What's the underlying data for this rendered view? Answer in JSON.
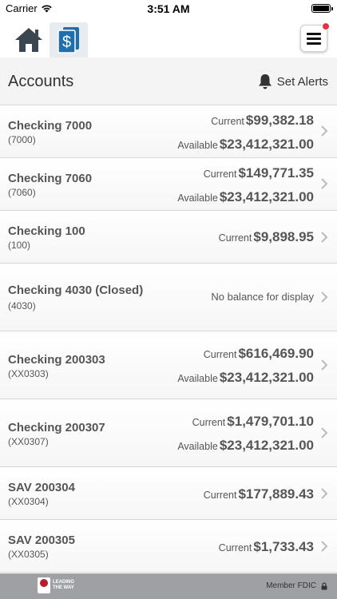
{
  "status_bar": {
    "carrier": "Carrier",
    "time": "3:51 AM"
  },
  "nav": {
    "home_icon": "house-icon",
    "accounts_icon": "dollar-document-icon",
    "menu_icon": "hamburger-icon"
  },
  "header": {
    "title": "Accounts",
    "alerts_label": "Set Alerts"
  },
  "accounts": [
    {
      "name": "Checking 7000",
      "number": "(7000)",
      "balances": [
        {
          "label": "Current",
          "amount": "$99,382.18"
        },
        {
          "label": "Available",
          "amount": "$23,412,321.00"
        }
      ]
    },
    {
      "name": "Checking 7060",
      "number": "(7060)",
      "balances": [
        {
          "label": "Current",
          "amount": "$149,771.35"
        },
        {
          "label": "Available",
          "amount": "$23,412,321.00"
        }
      ]
    },
    {
      "name": "Checking 100",
      "number": "(100)",
      "balances": [
        {
          "label": "Current",
          "amount": "$9,898.95"
        }
      ]
    },
    {
      "name": "Checking 4030 (Closed)",
      "number": "(4030)",
      "no_balance": "No balance for display"
    },
    {
      "name": "Checking 200303",
      "number": "(XX0303)",
      "balances": [
        {
          "label": "Current",
          "amount": "$616,469.90"
        },
        {
          "label": "Available",
          "amount": "$23,412,321.00"
        }
      ]
    },
    {
      "name": "Checking 200307",
      "number": "(XX0307)",
      "balances": [
        {
          "label": "Current",
          "amount": "$1,479,701.10"
        },
        {
          "label": "Available",
          "amount": "$23,412,321.00"
        }
      ]
    },
    {
      "name": "SAV 200304",
      "number": "(XX0304)",
      "balances": [
        {
          "label": "Current",
          "amount": "$177,889.43"
        }
      ]
    },
    {
      "name": "SAV 200305",
      "number": "(XX0305)",
      "balances": [
        {
          "label": "Current",
          "amount": "$1,733.43"
        }
      ]
    }
  ],
  "footer": {
    "logo_line1": "LEADING",
    "logo_line2": "THE WAY",
    "fdic": "Member FDIC"
  },
  "colors": {
    "accent_blue": "#1f6fae",
    "icon_dark": "#3a4650",
    "badge_red": "#e5333f",
    "footer_bg": "#9ea0a3"
  }
}
